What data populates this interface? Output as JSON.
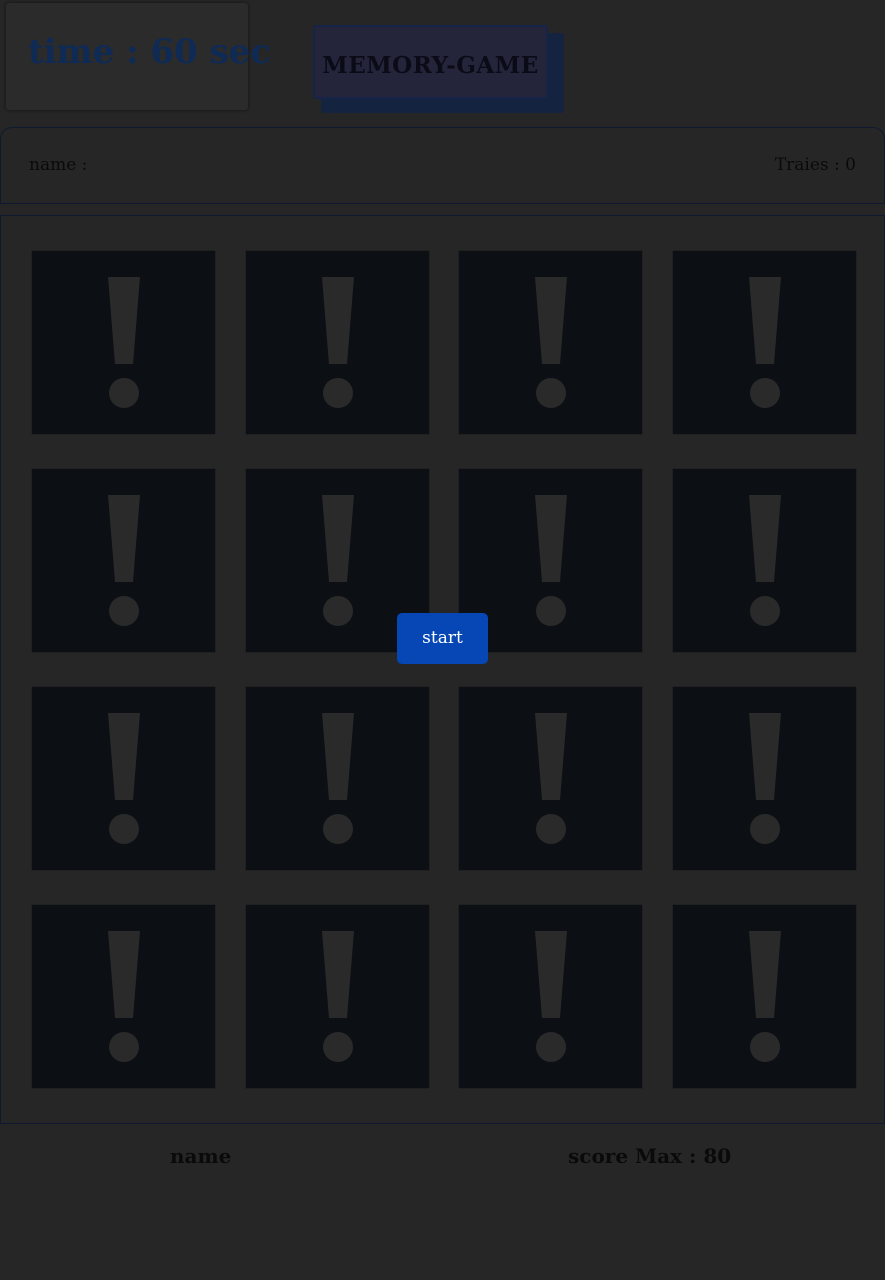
{
  "header": {
    "timer_text": "time : 60 sec",
    "title": "MEMORY-GAME"
  },
  "info_bar": {
    "name_label": "name :",
    "tries_label": "Traies : 0"
  },
  "board": {
    "cards": [
      {
        "face": "exclamation-icon"
      },
      {
        "face": "exclamation-icon"
      },
      {
        "face": "exclamation-icon"
      },
      {
        "face": "exclamation-icon"
      },
      {
        "face": "exclamation-icon"
      },
      {
        "face": "exclamation-icon"
      },
      {
        "face": "exclamation-icon"
      },
      {
        "face": "exclamation-icon"
      },
      {
        "face": "exclamation-icon"
      },
      {
        "face": "exclamation-icon"
      },
      {
        "face": "exclamation-icon"
      },
      {
        "face": "exclamation-icon"
      },
      {
        "face": "exclamation-icon"
      },
      {
        "face": "exclamation-icon"
      },
      {
        "face": "exclamation-icon"
      },
      {
        "face": "exclamation-icon"
      }
    ],
    "start_label": "start"
  },
  "footer": {
    "name_label": "name",
    "score_label": "score Max : 80"
  },
  "colors": {
    "background": "#262626",
    "card": "#0c0f14",
    "card_mark": "#2a2a2a",
    "start_button": "#0747b5",
    "timer_text": "#0e2a55"
  }
}
